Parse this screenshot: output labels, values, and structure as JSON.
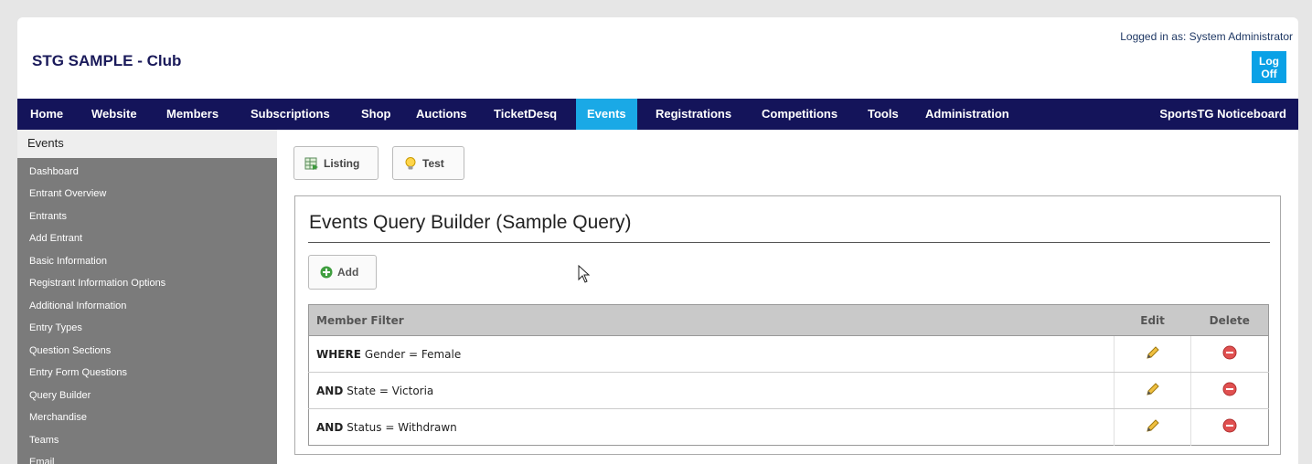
{
  "header": {
    "club_title": "STG SAMPLE - Club",
    "login_info": "Logged in as: System Administrator",
    "logoff_label": "Log Off",
    "accent_color": "#0aa1e6"
  },
  "nav": {
    "background": "#14145a",
    "active_color": "#1aa9e6",
    "items": [
      {
        "label": "Home"
      },
      {
        "label": "Website"
      },
      {
        "label": "Members"
      },
      {
        "label": "Subscriptions"
      },
      {
        "label": "Shop"
      },
      {
        "label": "Auctions"
      },
      {
        "label": "TicketDesq"
      },
      {
        "label": "Events",
        "active": true
      },
      {
        "label": "Registrations"
      },
      {
        "label": "Competitions"
      },
      {
        "label": "Tools"
      },
      {
        "label": "Administration"
      }
    ],
    "right_item": "SportsTG Noticeboard"
  },
  "sidebar": {
    "heading": "Events",
    "items": [
      {
        "label": "Dashboard"
      },
      {
        "label": "Entrant Overview"
      },
      {
        "label": "Entrants"
      },
      {
        "label": "Add Entrant"
      },
      {
        "label": "Basic Information"
      },
      {
        "label": "Registrant Information Options"
      },
      {
        "label": "Additional Information"
      },
      {
        "label": "Entry Types"
      },
      {
        "label": "Question Sections"
      },
      {
        "label": "Entry Form Questions"
      },
      {
        "label": "Query Builder"
      },
      {
        "label": "Merchandise"
      },
      {
        "label": "Teams"
      },
      {
        "label": "Email"
      }
    ]
  },
  "toolbar": {
    "listing_label": "Listing",
    "listing_icon": "table-export-icon",
    "test_label": "Test",
    "test_icon": "lightbulb-icon"
  },
  "panel": {
    "title": "Events Query Builder (Sample Query)",
    "add_label": "Add",
    "add_icon": "plus-circle-icon",
    "columns": {
      "filter": "Member Filter",
      "edit": "Edit",
      "delete": "Delete"
    },
    "rows": [
      {
        "keyword": "WHERE",
        "condition": "Gender = Female"
      },
      {
        "keyword": "AND",
        "condition": "State = Victoria"
      },
      {
        "keyword": "AND",
        "condition": "Status = Withdrawn"
      }
    ]
  }
}
